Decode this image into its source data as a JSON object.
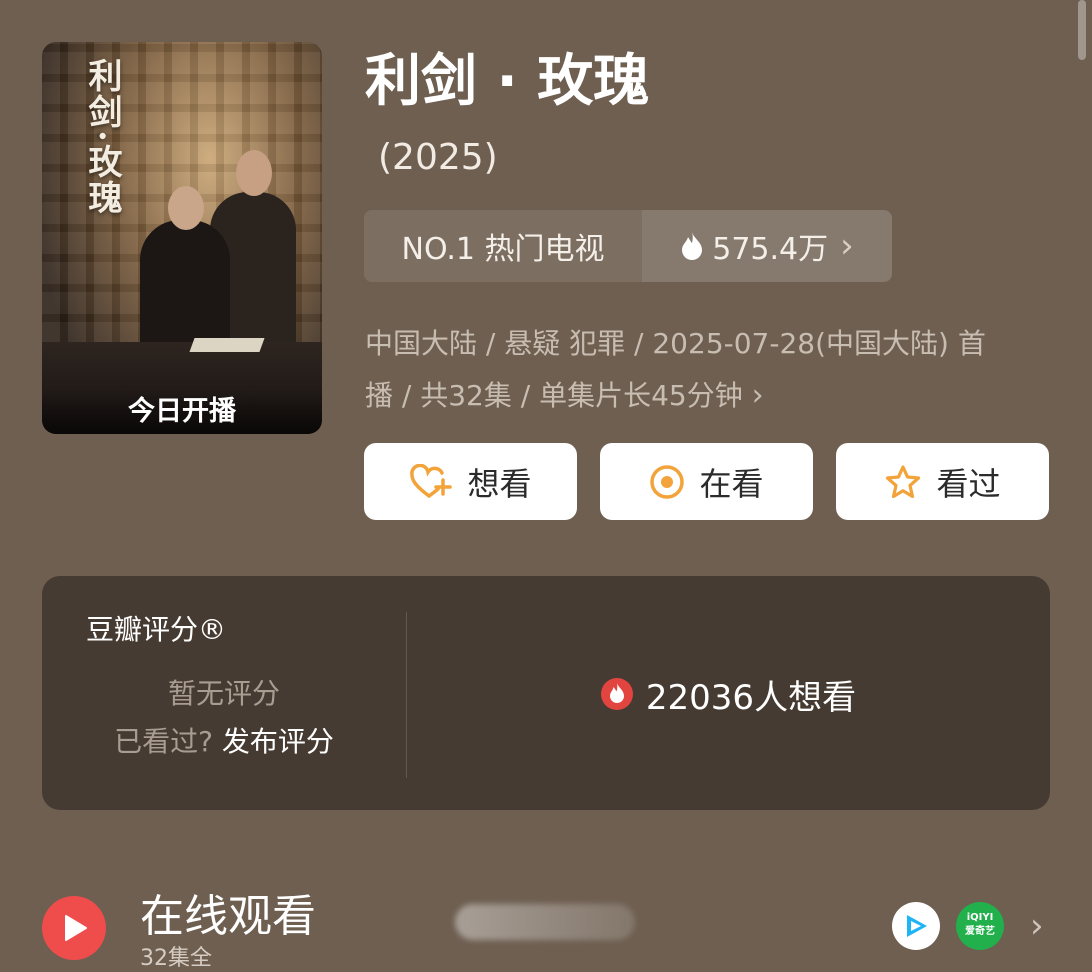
{
  "poster": {
    "vertical_title": "利剑·玫瑰",
    "caption": "今日开播"
  },
  "show": {
    "title": "利剑 · 玫瑰",
    "year": "(2025)"
  },
  "rank": {
    "label": "NO.1 热门电视",
    "heat": "575.4万",
    "icon": "flame-icon"
  },
  "meta": {
    "line1": "中国大陆 / 悬疑 犯罪 / 2025-07-28(中国大陆) 首",
    "line2": "播 / 共32集 / 单集片长45分钟"
  },
  "actions": {
    "want": "想看",
    "watching": "在看",
    "watched": "看过"
  },
  "rating": {
    "label": "豆瓣评分®",
    "no_rating": "暂无评分",
    "watched_prompt": "已看过?",
    "publish_link": "发布评分",
    "wish_count": "22036人想看"
  },
  "online": {
    "title": "在线观看",
    "subtitle": "32集全"
  },
  "colors": {
    "background": "#6e5f51",
    "card": "#463b32",
    "accent_orange": "#f2a33a",
    "play_red": "#ef4c4c"
  }
}
